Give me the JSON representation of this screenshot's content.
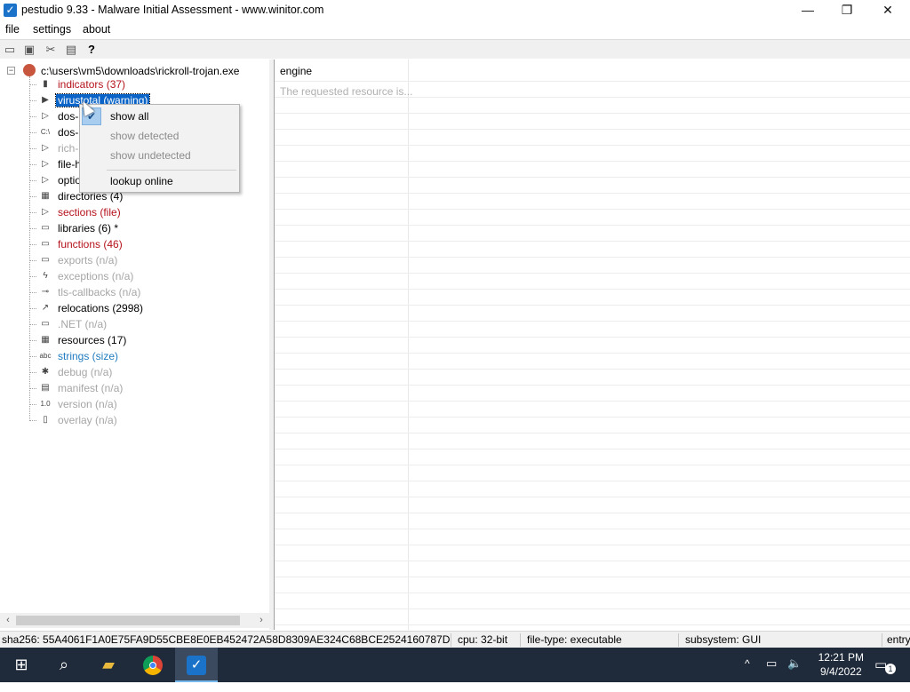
{
  "window": {
    "title": "pestudio 9.33 - Malware Initial Assessment - www.winitor.com",
    "minimize": "—",
    "maximize": "❐",
    "close": "✕",
    "app_icon": "checkmark-icon"
  },
  "menu": {
    "file": "file",
    "settings": "settings",
    "about": "about"
  },
  "toolbar": {
    "icons": [
      "open-folder-icon",
      "save-icon",
      "close-file-icon",
      "clipboard-icon",
      "help-icon"
    ]
  },
  "tree": {
    "root_label": "c:\\users\\vm5\\downloads\\rickroll-trojan.exe",
    "root_expander": "−",
    "items": [
      {
        "label": "indicators (37)",
        "icon": "bar-chart-icon",
        "glyph": "▮",
        "color": "red"
      },
      {
        "label": "virustotal (warning)",
        "icon": "virustotal-icon",
        "glyph": "▶",
        "color": "selected"
      },
      {
        "label": "dos-",
        "icon": "expand-arrow-icon",
        "glyph": "▷",
        "color": "black"
      },
      {
        "label": "dos-",
        "icon": "console-icon",
        "glyph": "C:\\",
        "color": "black"
      },
      {
        "label": "rich-",
        "icon": "expand-arrow-icon",
        "glyph": "▷",
        "color": "grey"
      },
      {
        "label": "file-h",
        "icon": "expand-arrow-icon",
        "glyph": "▷",
        "color": "black"
      },
      {
        "label": "optio",
        "icon": "expand-arrow-icon",
        "glyph": "▷",
        "color": "black"
      },
      {
        "label": "directories (4)",
        "icon": "directories-icon",
        "glyph": "▦",
        "color": "black"
      },
      {
        "label": "sections (file)",
        "icon": "expand-arrow-icon",
        "glyph": "▷",
        "color": "red"
      },
      {
        "label": "libraries (6) *",
        "icon": "library-icon",
        "glyph": "▭",
        "color": "black"
      },
      {
        "label": "functions (46)",
        "icon": "function-icon",
        "glyph": "▭",
        "color": "red"
      },
      {
        "label": "exports (n/a)",
        "icon": "exports-icon",
        "glyph": "▭",
        "color": "grey"
      },
      {
        "label": "exceptions (n/a)",
        "icon": "exceptions-icon",
        "glyph": "ϟ",
        "color": "grey"
      },
      {
        "label": "tls-callbacks (n/a)",
        "icon": "tls-callbacks-icon",
        "glyph": "⊸",
        "color": "grey"
      },
      {
        "label": "relocations (2998)",
        "icon": "relocations-icon",
        "glyph": "↗",
        "color": "black"
      },
      {
        "label": ".NET (n/a)",
        "icon": "dotnet-icon",
        "glyph": "▭",
        "color": "grey"
      },
      {
        "label": "resources (17)",
        "icon": "resources-icon",
        "glyph": "▦",
        "color": "black"
      },
      {
        "label": "strings (size)",
        "icon": "strings-icon",
        "glyph": "abc",
        "color": "blue"
      },
      {
        "label": "debug (n/a)",
        "icon": "debug-bug-icon",
        "glyph": "✱",
        "color": "grey"
      },
      {
        "label": "manifest (n/a)",
        "icon": "manifest-icon",
        "glyph": "▤",
        "color": "grey"
      },
      {
        "label": "version (n/a)",
        "icon": "version-icon",
        "glyph": "1.0",
        "color": "grey"
      },
      {
        "label": "overlay (n/a)",
        "icon": "overlay-icon",
        "glyph": "▯",
        "color": "grey"
      }
    ]
  },
  "context_menu": {
    "check": "✔",
    "items": [
      "show all",
      "show detected",
      "show undetected",
      "lookup online"
    ]
  },
  "details": {
    "column_header": "engine",
    "first_cell": "The requested resource is..."
  },
  "status": {
    "sha256": "sha256: 55A4061F1A0E75FA9D55CBE8E0EB452472A58D8309AE324C68BCE2524160787D",
    "cpu": "cpu: 32-bit",
    "file_type": "file-type: executable",
    "subsystem": "subsystem: GUI",
    "entry": "entry"
  },
  "taskbar": {
    "time": "12:21 PM",
    "date": "9/4/2022",
    "notification_count": "1"
  },
  "colors": {
    "selection": "#0a64c8",
    "red": "#b5121b",
    "blue": "#1f7bbf",
    "grey": "#a6a6a6",
    "taskbar": "#1f2a3a"
  }
}
